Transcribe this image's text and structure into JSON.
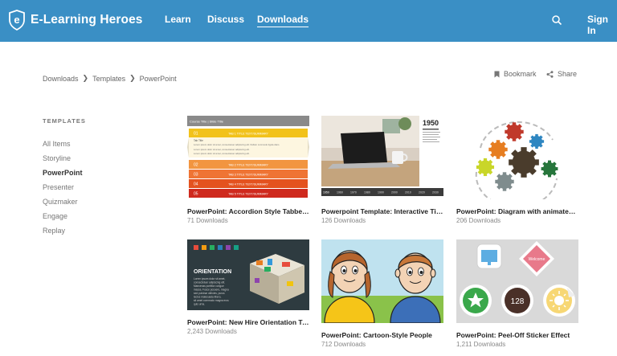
{
  "header": {
    "brand": "E-Learning Heroes",
    "brand_letter": "e",
    "nav": [
      {
        "label": "Learn",
        "active": false
      },
      {
        "label": "Discuss",
        "active": false
      },
      {
        "label": "Downloads",
        "active": true
      }
    ],
    "sign_in": "Sign In",
    "colors": {
      "bar": "#3a8fc5"
    }
  },
  "breadcrumb": [
    "Downloads",
    "Templates",
    "PowerPoint"
  ],
  "actions": {
    "bookmark": "Bookmark",
    "share": "Share"
  },
  "sidebar": {
    "heading": "TEMPLATES",
    "items": [
      {
        "label": "All Items",
        "active": false
      },
      {
        "label": "Storyline",
        "active": false
      },
      {
        "label": "PowerPoint",
        "active": true
      },
      {
        "label": "Presenter",
        "active": false
      },
      {
        "label": "Quizmaker",
        "active": false
      },
      {
        "label": "Engage",
        "active": false
      },
      {
        "label": "Replay",
        "active": false
      }
    ]
  },
  "cards": [
    {
      "title": "PowerPoint: Accordion Style Tabbed Interaction",
      "downloads": "71 Downloads",
      "thumb": {
        "header_left": "Course Title | Slide Title",
        "tab_rows": [
          {
            "num": "01",
            "text": "TAB 1 TITLE TEXT/SUMMARY",
            "color": "#f2c21b"
          },
          {
            "num": "02",
            "text": "TAB 2 TITLE TEXT/SUMMARY",
            "color": "#f29540"
          },
          {
            "num": "03",
            "text": "TAB 3 TITLE TEXT/SUMMARY",
            "color": "#ef7434"
          },
          {
            "num": "04",
            "text": "TAB 4 TITLE TEXT/SUMMARY",
            "color": "#e4521f"
          },
          {
            "num": "05",
            "text": "TAB 5 TITLE TEXT/SUMMARY",
            "color": "#cf2a1e"
          }
        ],
        "body_lines": [
          "Tab Title",
          "Lorem ipsum dolor sit amet, consectetuer adipiscing elit. Nullam commodo ligula diam.",
          "Lorem ipsum dolor sit amet, consectetuer adipiscing elit.",
          "Lorem ipsum dolor sit amet, consectetuer adipiscing elit."
        ]
      }
    },
    {
      "title": "Powerpoint Template: Interactive Timeline",
      "downloads": "126 Downloads",
      "thumb": {
        "year": "1950",
        "ticks": [
          "1950",
          "1960",
          "1970",
          "1980",
          "1990",
          "2000",
          "2010",
          "2020",
          "2030"
        ]
      }
    },
    {
      "title": "PowerPoint: Diagram with animated gears",
      "downloads": "206 Downloads"
    },
    {
      "title": "PowerPoint: New Hire Orientation Template",
      "downloads": "2,243 Downloads",
      "thumb": {
        "heading": "ORIENTATION",
        "lines": [
          "Lorem ipsum dolor sit amet,",
          "consectetuer adipiscing elit.",
          "Maecenas porttitor congue",
          "massa. Fusce posuere, magna",
          "sed pulvinar ultricies, purus",
          "lectus malesuada libero,",
          "sit amet commodo magna eros",
          "quis urna."
        ]
      }
    },
    {
      "title": "PowerPoint: Cartoon-Style People",
      "downloads": "712 Downloads"
    },
    {
      "title": "PowerPoint: Peel-Off Sticker Effect",
      "downloads": "1,211 Downloads",
      "thumb": {
        "welcome": "Welcome",
        "number": "128"
      }
    }
  ]
}
